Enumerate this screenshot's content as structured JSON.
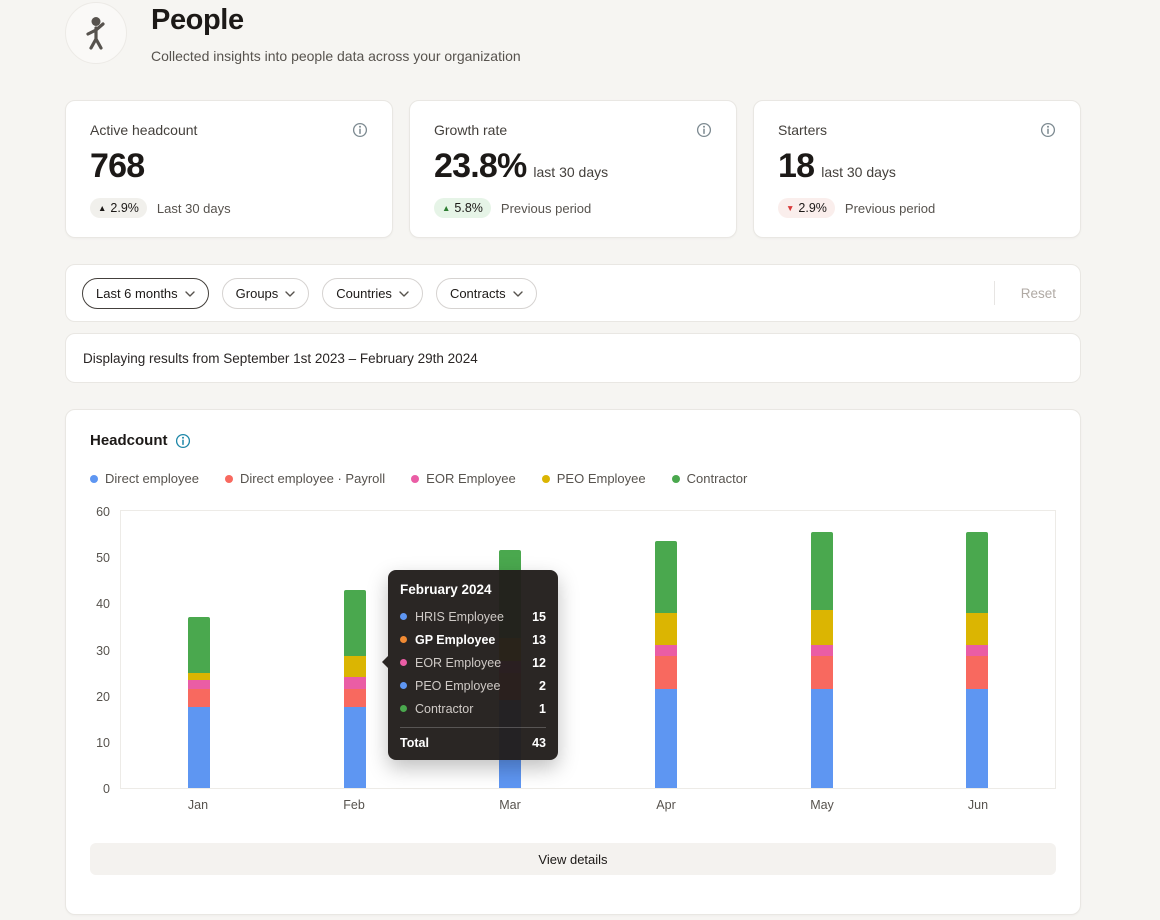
{
  "page": {
    "title": "People",
    "subtitle": "Collected insights into people data across your organization"
  },
  "stats": [
    {
      "title": "Active headcount",
      "value": "768",
      "value_suffix": "",
      "badge": "2.9%",
      "badge_dir": "up",
      "badge_tone": "neutral",
      "badge_caption": "Last 30 days"
    },
    {
      "title": "Growth rate",
      "value": "23.8%",
      "value_suffix": "last 30 days",
      "badge": "5.8%",
      "badge_dir": "up",
      "badge_tone": "positive",
      "badge_caption": "Previous period"
    },
    {
      "title": "Starters",
      "value": "18",
      "value_suffix": "last 30 days",
      "badge": "2.9%",
      "badge_dir": "down",
      "badge_tone": "negative",
      "badge_caption": "Previous period"
    }
  ],
  "filters": {
    "items": [
      {
        "label": "Last 6 months",
        "active": true
      },
      {
        "label": "Groups",
        "active": false
      },
      {
        "label": "Countries",
        "active": false
      },
      {
        "label": "Contracts",
        "active": false
      }
    ],
    "reset_label": "Reset"
  },
  "results_notice": "Displaying results from September 1st 2023 – February 29th 2024",
  "chart": {
    "title": "Headcount",
    "view_details_label": "View details"
  },
  "chart_data": {
    "type": "bar",
    "stacked": true,
    "title": "Headcount",
    "categories": [
      "Jan",
      "Feb",
      "Mar",
      "Apr",
      "May",
      "Jun"
    ],
    "series": [
      {
        "name": "Direct employee",
        "color": "#5E96F2",
        "values": [
          17.5,
          17.5,
          19,
          21.5,
          21.5,
          21.5
        ]
      },
      {
        "name": "Direct employee · Payroll",
        "color": "#F8695F",
        "values": [
          4,
          4,
          6,
          7,
          7,
          7
        ]
      },
      {
        "name": "EOR Employee",
        "color": "#EA5DA5",
        "values": [
          2,
          2.5,
          2.5,
          2.5,
          2.5,
          2.5
        ]
      },
      {
        "name": "PEO Employee",
        "color": "#DBB502",
        "values": [
          1.5,
          4.5,
          5,
          7,
          7.5,
          7
        ]
      },
      {
        "name": "Contractor",
        "color": "#4AA84E",
        "values": [
          12,
          14.5,
          19,
          15.5,
          17,
          17.5
        ]
      }
    ],
    "ylim": [
      0,
      60
    ],
    "yticks": [
      0,
      10,
      20,
      30,
      40,
      50,
      60
    ],
    "legend_position": "top",
    "grid": false
  },
  "tooltip": {
    "title": "February 2024",
    "rows": [
      {
        "label": "HRIS Employee",
        "value": "15",
        "color": "#5E96F2",
        "bold": false
      },
      {
        "label": "GP Employee",
        "value": "13",
        "color": "#F08A33",
        "bold": true
      },
      {
        "label": "EOR Employee",
        "value": "12",
        "color": "#EA5DA5",
        "bold": false
      },
      {
        "label": "PEO Employee",
        "value": "2",
        "color": "#5E96F2",
        "bold": false
      },
      {
        "label": "Contractor",
        "value": "1",
        "color": "#4AA84E",
        "bold": false
      }
    ],
    "total_label": "Total",
    "total_value": "43"
  }
}
